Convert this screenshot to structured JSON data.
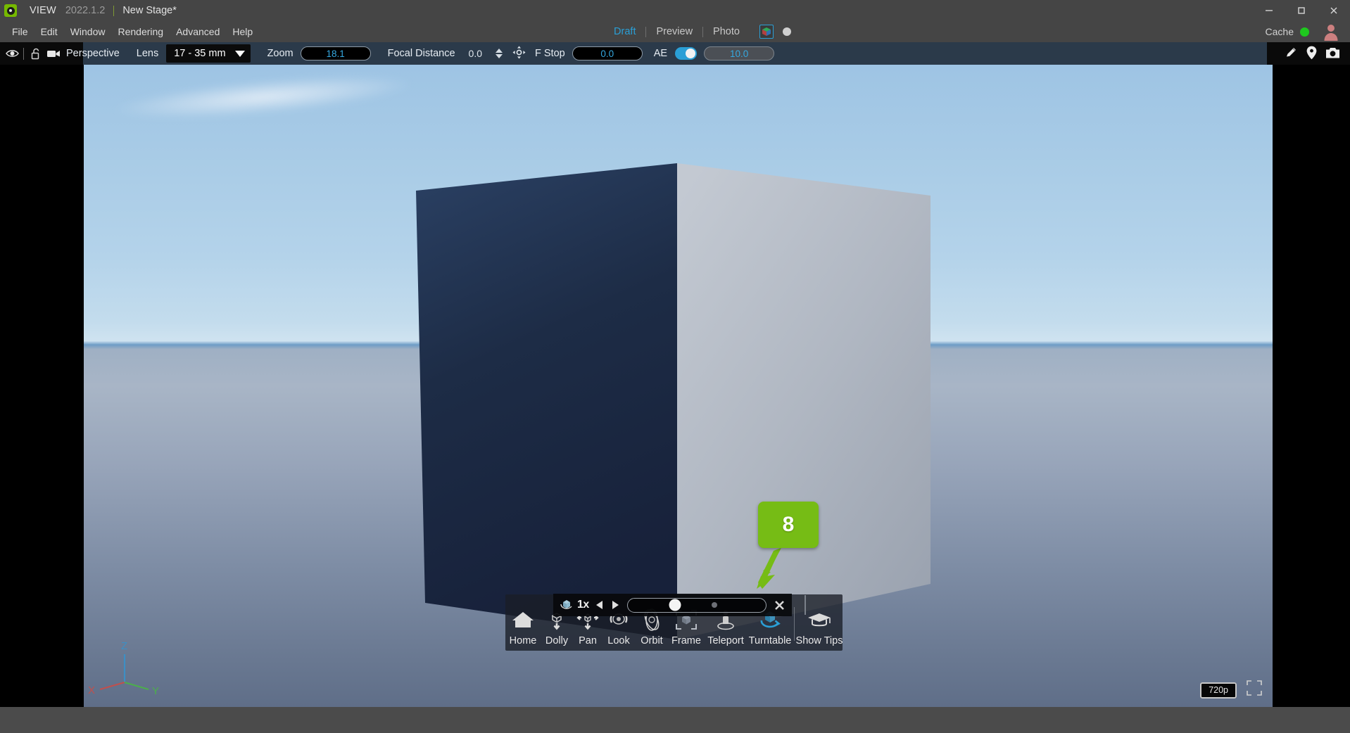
{
  "titlebar": {
    "logo_icon": "omniverse-logo-icon",
    "app_name": "VIEW",
    "version": "2022.1.2",
    "stage_name": "New Stage*",
    "minimize_icon": "minimize-icon",
    "maximize_icon": "maximize-icon",
    "close_icon": "close-icon"
  },
  "menubar": {
    "items": [
      {
        "label": "File"
      },
      {
        "label": "Edit"
      },
      {
        "label": "Window"
      },
      {
        "label": "Rendering"
      },
      {
        "label": "Advanced"
      },
      {
        "label": "Help"
      }
    ],
    "modes": [
      {
        "label": "Draft",
        "active": true
      },
      {
        "label": "Preview",
        "active": false
      },
      {
        "label": "Photo",
        "active": false
      }
    ],
    "cube_icon": "render-cube-icon",
    "circle_icon": "render-sphere-icon",
    "cache_label": "Cache",
    "cache_status_color": "#1ec81e",
    "avatar_icon": "user-avatar-icon"
  },
  "viewport_toolbar": {
    "eye_icon": "eye-visibility-icon",
    "lock_icon": "lock-open-icon",
    "camera_icon": "camera-icon",
    "camera_name": "Perspective",
    "lens_label": "Lens",
    "lens_value": "17 - 35 mm",
    "lens_caret_icon": "chevron-down-icon",
    "zoom_label": "Zoom",
    "zoom_value": "18.1",
    "focal_distance_label": "Focal Distance",
    "focal_distance_value": "0.0",
    "spinner_icon": "up-down-spinner-icon",
    "target_icon": "focus-target-icon",
    "fstop_label": "F Stop",
    "fstop_value": "0.0",
    "ae_label": "AE",
    "ae_enabled": true,
    "ae_value": "10.0",
    "pencil_icon": "pencil-icon",
    "pin_icon": "location-pin-icon",
    "snapshot_icon": "camera-snapshot-icon",
    "accent_color": "#2a9fd6",
    "background_color": "#2b3a4a"
  },
  "viewport": {
    "gizmo": {
      "x_label": "X",
      "y_label": "Y",
      "z_label": "Z",
      "x_color": "#c0504d",
      "y_color": "#4cae4c",
      "z_color": "#3d8fc4"
    },
    "resolution_label": "720p",
    "resolution_icon": "monitor-icon",
    "fullscreen_icon": "fullscreen-expand-icon"
  },
  "navbar": {
    "items": [
      {
        "label": "Home",
        "icon": "home-icon",
        "active": false
      },
      {
        "label": "Dolly",
        "icon": "dolly-icon",
        "active": false
      },
      {
        "label": "Pan",
        "icon": "pan-icon",
        "active": false
      },
      {
        "label": "Look",
        "icon": "look-icon",
        "active": false
      },
      {
        "label": "Orbit",
        "icon": "orbit-icon",
        "active": false
      },
      {
        "label": "Frame",
        "icon": "frame-icon",
        "active": false
      },
      {
        "label": "Teleport",
        "icon": "teleport-icon",
        "active": false
      },
      {
        "label": "Turntable",
        "icon": "turntable-icon",
        "active": true
      },
      {
        "label": "Show Tips",
        "icon": "graduation-cap-icon",
        "active": false
      }
    ],
    "active_color": "#2a9fd6"
  },
  "speed_popup": {
    "cube_icon": "turntable-cube-icon",
    "rate_label": "1x",
    "prev_icon": "prev-triangle-icon",
    "next_icon": "next-triangle-icon",
    "slider_value_percent": 34,
    "slider_tick_percent": 63,
    "close_icon": "close-x-icon"
  },
  "callout": {
    "step_number": "8",
    "color": "#76bc15",
    "arrow_icon": "callout-arrow-icon"
  }
}
